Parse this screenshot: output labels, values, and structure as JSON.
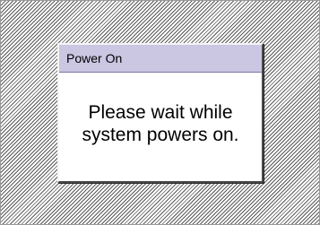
{
  "dialog": {
    "title": "Power On",
    "message_lines": [
      "Please wait while",
      "system powers on."
    ]
  },
  "colors": {
    "titlebar": "#cbc6e2",
    "pattern": "#5a5a5a",
    "dialog_background": "#ffffff"
  }
}
